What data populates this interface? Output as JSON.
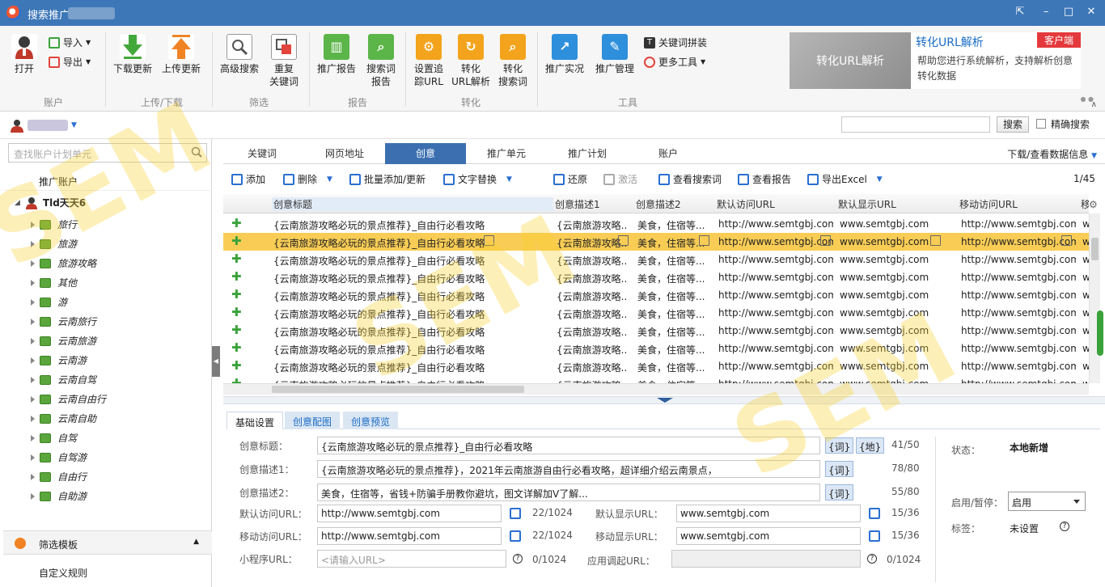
{
  "window": {
    "title": "搜索推广",
    "minimize_label": "–",
    "maximize_label": "□",
    "close_label": "✕",
    "pin_label": "⇱"
  },
  "ribbon": {
    "open": "打开",
    "import": "导入",
    "export": "导出",
    "download_update": "下载更新",
    "upload_update": "上传更新",
    "advanced_search": "高级搜索",
    "dup_keywords_1": "重复",
    "dup_keywords_2": "关键词",
    "promo_report": "推广报告",
    "search_term_1": "搜索词",
    "search_term_2": "报告",
    "set_tracking_1": "设置追",
    "set_tracking_2": "踪URL",
    "conv_url_1": "转化",
    "conv_url_2": "URL解析",
    "conv_search_1": "转化",
    "conv_search_2": "搜索词",
    "promo_live": "推广实况",
    "promo_manage": "推广管理",
    "keyword_combine": "关键词拼装",
    "more_tools": "更多工具",
    "groups": {
      "account": "账户",
      "updown": "上传/下载",
      "filter": "筛选",
      "report": "报告",
      "convert": "转化",
      "tools": "工具"
    }
  },
  "promo": {
    "image_text": "转化URL解析",
    "title": "转化URL解析",
    "badge": "客户端",
    "desc": "帮助您进行系统解析，支持解析创意转化数据"
  },
  "account_bar": {
    "search_button": "搜索",
    "exact_search": "精确搜索"
  },
  "left": {
    "search_placeholder": "查找账户计划单元",
    "header": "推广账户",
    "root": "Tld天天6",
    "items": [
      "旅行",
      "旅游",
      "旅游攻略",
      "其他",
      "游",
      "云南旅行",
      "云南旅游",
      "云南游",
      "云南自驾",
      "云南自由行",
      "云南自助",
      "自驾",
      "自驾游",
      "自由行",
      "自助游"
    ],
    "filter_template": "筛选模板",
    "custom_rule": "自定义规则"
  },
  "tabs": {
    "items": [
      "关键词",
      "网页地址",
      "创意",
      "推广单元",
      "推广计划",
      "账户"
    ],
    "right": "下载/查看数据信息"
  },
  "toolbar": {
    "add": "添加",
    "delete": "删除",
    "batch_add": "批量添加/更新",
    "text_replace": "文字替换",
    "restore": "还原",
    "activate": "激活",
    "view_search": "查看搜索词",
    "view_report": "查看报告",
    "export_excel": "导出Excel",
    "page": "1/45"
  },
  "grid": {
    "headers": [
      "创意标题",
      "创意描述1",
      "创意描述2",
      "默认访问URL",
      "默认显示URL",
      "移动访问URL",
      "移"
    ],
    "row": {
      "title": "{云南旅游攻略必玩的景点推荐}_自由行必看攻略",
      "desc1": "{云南旅游攻略...",
      "desc2": "美食，住宿等...",
      "url": "http://www.semtgbj.com",
      "display": "www.semtgbj.com",
      "murl": "http://www.semtgbj.com",
      "extra": "w"
    }
  },
  "detail": {
    "tabs": [
      "基础设置",
      "创意配图",
      "创意预览"
    ],
    "title_label": "创意标题：",
    "title_value": "{云南旅游攻略必玩的景点推荐}_自由行必看攻略",
    "title_count": "41/50",
    "desc1_label": "创意描述1：",
    "desc1_value": "{云南旅游攻略必玩的景点推荐}，2021年云南旅游自由行必看攻略，超详细介绍云南景点，",
    "desc1_count": "78/80",
    "desc2_label": "创意描述2：",
    "desc2_value": "美食，住宿等，省钱+防骗手册教你避坑，图文详解加V了解...",
    "desc2_count": "55/80",
    "tag_word": "{词}",
    "tag_place": "{地}",
    "default_url_label": "默认访问URL：",
    "default_url": "http://www.semtgbj.com",
    "default_url_count": "22/1024",
    "default_display_label": "默认显示URL：",
    "default_display": "www.semtgbj.com",
    "default_display_count": "15/36",
    "mobile_url_label": "移动访问URL：",
    "mobile_url": "http://www.semtgbj.com",
    "mobile_url_count": "22/1024",
    "mobile_display_label": "移动显示URL：",
    "mobile_display": "www.semtgbj.com",
    "mobile_display_count": "15/36",
    "mini_label": "小程序URL：",
    "mini_placeholder": "<请输入URL>",
    "mini_count": "0/1024",
    "app_label": "应用调起URL：",
    "app_count": "0/1024",
    "status_label": "状态：",
    "status_value": "本地新增",
    "enable_label": "启用/暂停：",
    "enable_value": "启用",
    "tag_label": "标签：",
    "tag_value": "未设置",
    "help": "?"
  }
}
